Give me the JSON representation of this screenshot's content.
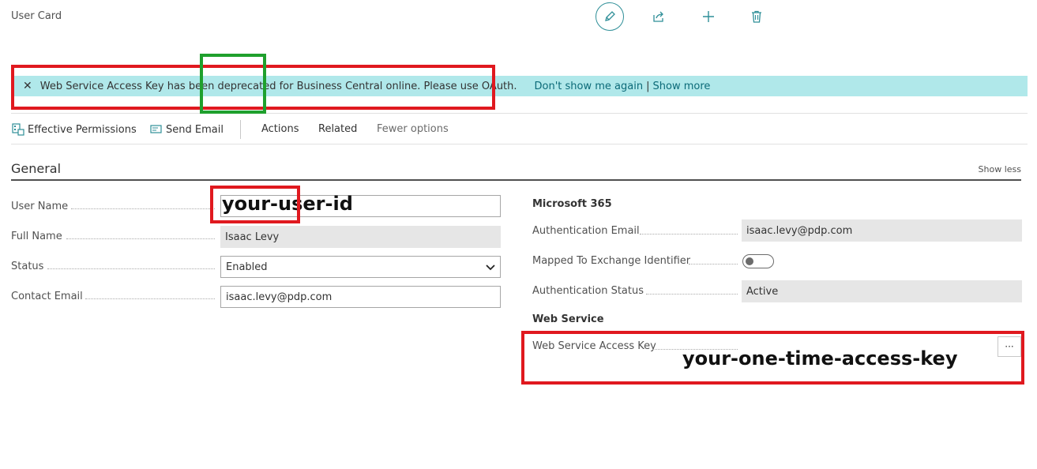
{
  "header": {
    "title": "User Card"
  },
  "toolbar_icons": [
    "edit-icon",
    "share-icon",
    "plus-icon",
    "trash-icon"
  ],
  "banner": {
    "message": "Web Service Access Key has been deprecated for Business Central online. Please use OAuth.",
    "dont_show": "Don't show me again",
    "separator": "|",
    "show_more": "Show more"
  },
  "actions": {
    "effective_permissions": "Effective Permissions",
    "send_email": "Send Email",
    "actions": "Actions",
    "related": "Related",
    "fewer_options": "Fewer options"
  },
  "general": {
    "title": "General",
    "show_less": "Show less",
    "user_name_label": "User Name",
    "user_name_value": "your-user-id",
    "full_name_label": "Full Name",
    "full_name_value": "Isaac Levy",
    "status_label": "Status",
    "status_value": "Enabled",
    "contact_email_label": "Contact Email",
    "contact_email_value": "isaac.levy@pdp.com"
  },
  "m365": {
    "title": "Microsoft 365",
    "auth_email_label": "Authentication Email",
    "auth_email_value": "isaac.levy@pdp.com",
    "mapped_label": "Mapped To Exchange Identifier",
    "mapped_on": false,
    "auth_status_label": "Authentication Status",
    "auth_status_value": "Active"
  },
  "web_service": {
    "title": "Web Service",
    "access_key_label": "Web Service Access Key",
    "access_key_value": "your-one-time-access-key",
    "more_label": "···"
  },
  "colors": {
    "banner_bg": "#b0e8ea",
    "accent": "#2f8f98",
    "annotation_red": "#e0191f",
    "annotation_green": "#1fa02d"
  }
}
